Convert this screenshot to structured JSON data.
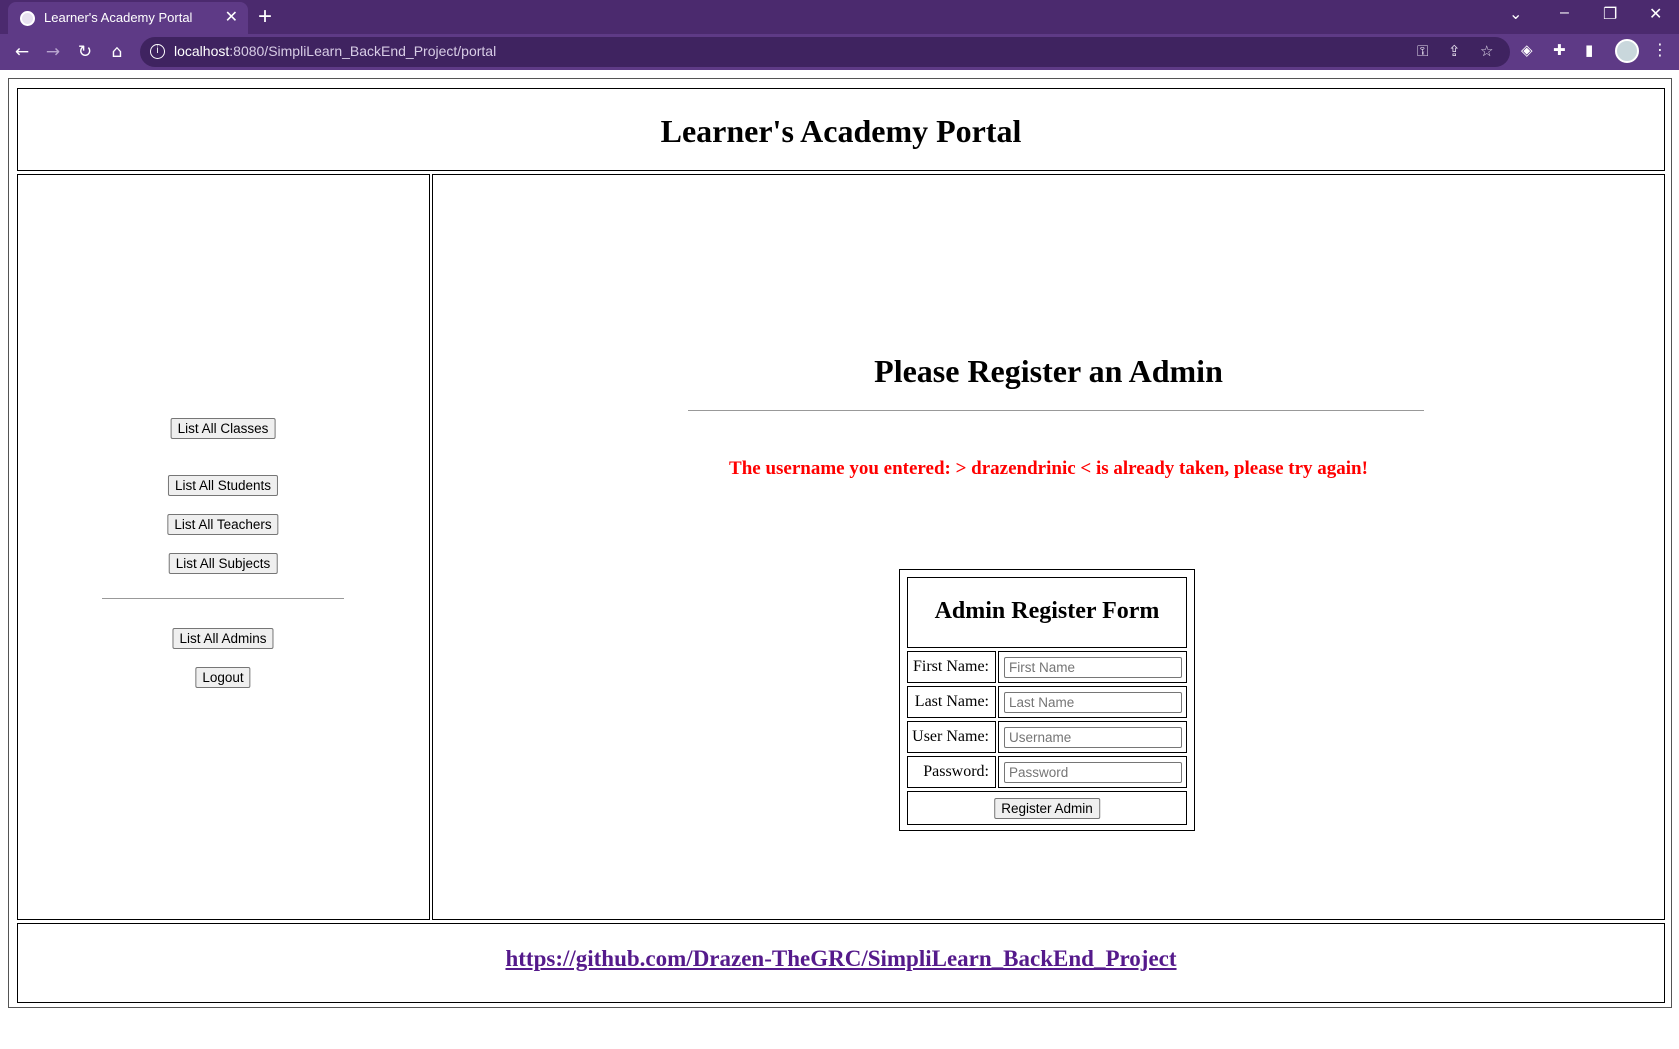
{
  "browser": {
    "tab_title": "Learner's Academy Portal",
    "tab_close": "✕",
    "new_tab": "+",
    "url_host": "localhost",
    "url_path": ":8080/SimpliLearn_BackEnd_Project/portal",
    "window_controls": {
      "dropdown": "⌄",
      "minimize": "–",
      "restore": "❐",
      "close": "✕"
    },
    "nav_icons": {
      "back": "←",
      "forward": "→",
      "reload": "↻",
      "home": "⌂"
    },
    "theme_color": "#4b2a6e"
  },
  "header": {
    "title": "Learner's Academy Portal"
  },
  "sidebar": {
    "buttons": {
      "classes": "List All Classes",
      "students": "List All Students",
      "teachers": "List All Teachers",
      "subjects": "List All Subjects",
      "admins": "List All Admins",
      "logout": "Logout"
    }
  },
  "main": {
    "title": "Please Register an Admin",
    "error": "The username you entered: > drazendrinic < is already taken, please try again!",
    "error_color": "#ff0000",
    "form": {
      "title": "Admin Register Form",
      "first_name_label": "First Name:",
      "first_name_placeholder": "First Name",
      "last_name_label": "Last Name:",
      "last_name_placeholder": "Last Name",
      "user_name_label": "User Name:",
      "user_name_placeholder": "Username",
      "password_label": "Password:",
      "password_placeholder": "Password",
      "submit": "Register Admin"
    }
  },
  "footer": {
    "link": "https://github.com/Drazen-TheGRC/SimpliLearn_BackEnd_Project",
    "link_color": "#551a8b"
  }
}
